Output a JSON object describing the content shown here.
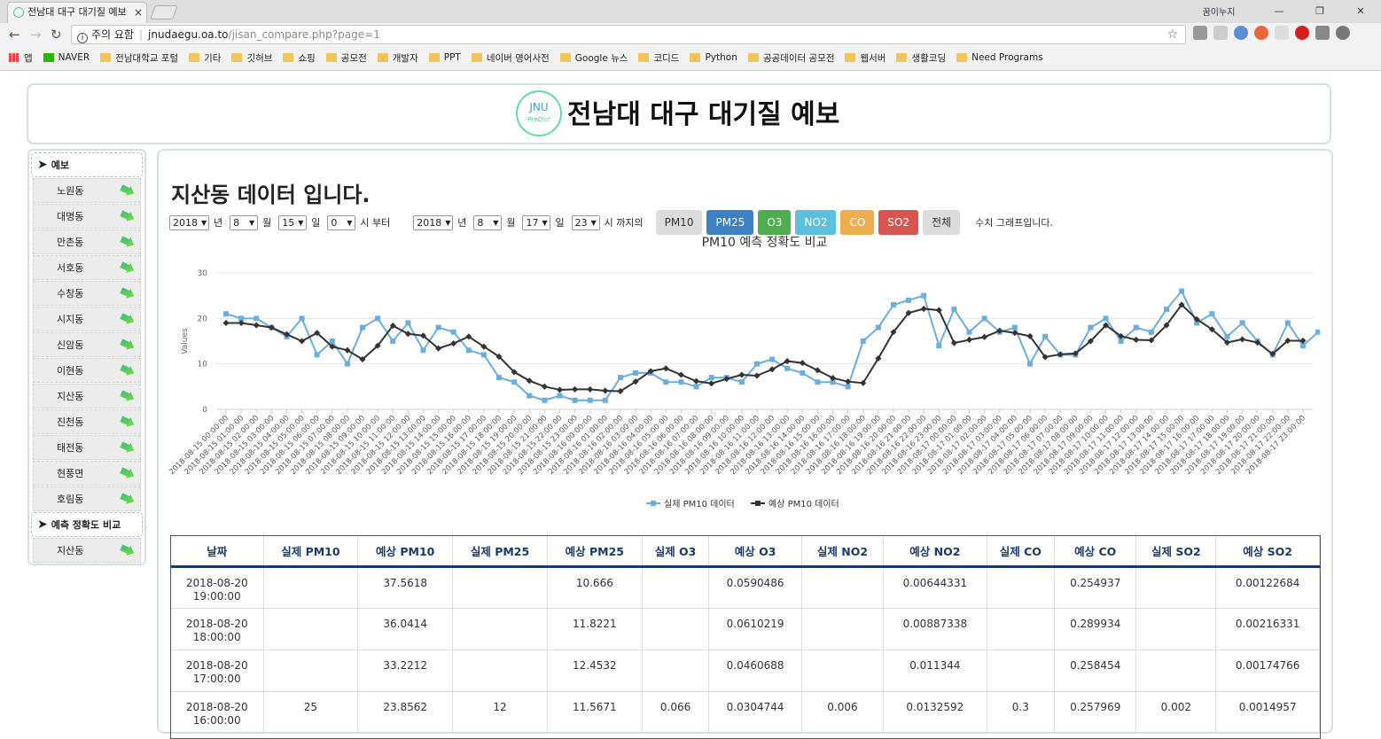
{
  "browser": {
    "tab_title": "전남대 대구 대기질 예보",
    "tab_close": "×",
    "user": "꿈이누지",
    "url_warning": "주의 요함",
    "url_host": "jnudaegu.oa.to",
    "url_path": "/jisan_compare.php?page=1",
    "bookmarks": [
      "앱",
      "NAVER",
      "전남대학교 포털",
      "기타",
      "깃허브",
      "쇼핑",
      "공모전",
      "개발자",
      "PPT",
      "네이버 영어사전",
      "Google 뉴스",
      "코디드",
      "Python",
      "공공데이터 공모전",
      "웹서버",
      "생활코딩",
      "Need Programs"
    ]
  },
  "header": {
    "logo_top": "JNU",
    "logo_bottom": "PreDict",
    "title": "전남대 대구 대기질 예보"
  },
  "sidebar": {
    "section1": "예보",
    "items": [
      "노원동",
      "대명동",
      "만촌동",
      "서호동",
      "수창동",
      "시지동",
      "신암동",
      "이현동",
      "지산동",
      "진천동",
      "태전동",
      "현풍면",
      "호림동"
    ],
    "section2": "예측 정확도 비교",
    "items2": [
      "지산동"
    ]
  },
  "page": {
    "title": "지산동 데이터 입니다."
  },
  "controls": {
    "from": {
      "year": "2018",
      "month": "8",
      "day": "15",
      "hour": "0"
    },
    "to": {
      "year": "2018",
      "month": "8",
      "day": "17",
      "hour": "23"
    },
    "year_label": "년",
    "month_label": "월",
    "day_label": "일",
    "from_suffix": "시 부터",
    "to_suffix": "시 까지의",
    "graph_note": "수치 그래프입니다."
  },
  "buttons": [
    {
      "label": "PM10",
      "color": "#dcdcdc",
      "text": "#333"
    },
    {
      "label": "PM25",
      "color": "#3b82c4",
      "text": "#fff"
    },
    {
      "label": "O3",
      "color": "#4cae4c",
      "text": "#fff"
    },
    {
      "label": "NO2",
      "color": "#5bc0de",
      "text": "#fff"
    },
    {
      "label": "CO",
      "color": "#f0ad4e",
      "text": "#fff"
    },
    {
      "label": "SO2",
      "color": "#d9534f",
      "text": "#fff"
    },
    {
      "label": "전체",
      "color": "#dcdcdc",
      "text": "#333"
    }
  ],
  "chart_data": {
    "type": "line",
    "title": "PM10 예측 정확도 비교",
    "ylabel": "Values",
    "ylim": [
      0,
      30
    ],
    "yticks": [
      0,
      10,
      20,
      30
    ],
    "start": "2018-08-15 00:00:00",
    "x_labels": [
      "2018-08-15 00:00:00",
      "2018-08-15 01:00:00",
      "2018-08-15 02:00:00",
      "2018-08-15 03:00:00",
      "2018-08-15 04:00:00",
      "2018-08-15 05:00:00",
      "2018-08-15 06:00:00",
      "2018-08-15 07:00:00",
      "2018-08-15 08:00:00",
      "2018-08-15 09:00:00",
      "2018-08-15 10:00:00",
      "2018-08-15 11:00:00",
      "2018-08-15 12:00:00",
      "2018-08-15 13:00:00",
      "2018-08-15 14:00:00",
      "2018-08-15 15:00:00",
      "2018-08-15 16:00:00",
      "2018-08-15 17:00:00",
      "2018-08-15 18:00:00",
      "2018-08-15 19:00:00",
      "2018-08-15 20:00:00",
      "2018-08-15 21:00:00",
      "2018-08-15 22:00:00",
      "2018-08-15 23:00:00",
      "2018-08-16 00:00:00",
      "2018-08-16 01:00:00",
      "2018-08-16 02:00:00",
      "2018-08-16 03:00:00",
      "2018-08-16 04:00:00",
      "2018-08-16 05:00:00",
      "2018-08-16 06:00:00",
      "2018-08-16 07:00:00",
      "2018-08-16 08:00:00",
      "2018-08-16 09:00:00",
      "2018-08-16 10:00:00",
      "2018-08-16 11:00:00",
      "2018-08-16 12:00:00",
      "2018-08-16 13:00:00",
      "2018-08-16 14:00:00",
      "2018-08-16 15:00:00",
      "2018-08-16 16:00:00",
      "2018-08-16 17:00:00",
      "2018-08-16 18:00:00",
      "2018-08-16 19:00:00",
      "2018-08-16 20:00:00",
      "2018-08-16 21:00:00",
      "2018-08-16 22:00:00",
      "2018-08-16 23:00:00",
      "2018-08-17 00:00:00",
      "2018-08-17 01:00:00",
      "2018-08-17 02:00:00",
      "2018-08-17 03:00:00",
      "2018-08-17 04:00:00",
      "2018-08-17 05:00:00",
      "2018-08-17 06:00:00",
      "2018-08-17 07:00:00",
      "2018-08-17 08:00:00",
      "2018-08-17 09:00:00",
      "2018-08-17 10:00:00",
      "2018-08-17 11:00:00",
      "2018-08-17 12:00:00",
      "2018-08-17 13:00:00",
      "2018-08-17 14:00:00",
      "2018-08-17 15:00:00",
      "2018-08-17 16:00:00",
      "2018-08-17 17:00:00",
      "2018-08-17 18:00:00",
      "2018-08-17 19:00:00",
      "2018-08-17 20:00:00",
      "2018-08-17 21:00:00",
      "2018-08-17 22:00:00",
      "2018-08-17 23:00:00"
    ],
    "series": [
      {
        "name": "실제 PM10 데이터",
        "color": "#6aaee0",
        "values": [
          21,
          20,
          20,
          18,
          16,
          20,
          12,
          15,
          10,
          18,
          20,
          15,
          19,
          13,
          18,
          17,
          13,
          12,
          7,
          6,
          3,
          2,
          3,
          2,
          2,
          2,
          7,
          8,
          8,
          6,
          6,
          5,
          7,
          7,
          6,
          10,
          11,
          9,
          8,
          6,
          6,
          5,
          15,
          18,
          23,
          24,
          25,
          14,
          22,
          17,
          20,
          17,
          18,
          10,
          16,
          12,
          12,
          18,
          20,
          15,
          18,
          17,
          22,
          26,
          19,
          21,
          16,
          19,
          15,
          12,
          19,
          14,
          17
        ]
      },
      {
        "name": "예상 PM10 데이터",
        "color": "#333333",
        "values": [
          19,
          19,
          18.5,
          18,
          16.5,
          15,
          16.8,
          13.8,
          13,
          11,
          14,
          18.4,
          16.6,
          16.2,
          13.4,
          14.5,
          16,
          13.8,
          11.6,
          8.2,
          6.3,
          5,
          4.3,
          4.4,
          4.4,
          4.1,
          4,
          6.1,
          8.4,
          9,
          7.6,
          6.2,
          5.7,
          6.7,
          7.6,
          7.4,
          8.8,
          10.6,
          10.2,
          8.6,
          6.9,
          6.1,
          5.8,
          11.2,
          17,
          21.2,
          22.1,
          21.8,
          14.6,
          15.3,
          15.9,
          17.3,
          16.8,
          16.1,
          11.5,
          12.1,
          12.3,
          15,
          18.5,
          16.1,
          15.3,
          15.2,
          18.5,
          23,
          19.8,
          17.6,
          14.7,
          15.4,
          14.7,
          12.2,
          15.1,
          15.1
        ]
      }
    ]
  },
  "table": {
    "headers": [
      "날짜",
      "실제 PM10",
      "예상 PM10",
      "실제 PM25",
      "예상 PM25",
      "실제 O3",
      "예상 O3",
      "실제 NO2",
      "예상 NO2",
      "실제 CO",
      "예상 CO",
      "실제 SO2",
      "예상 SO2"
    ],
    "rows": [
      [
        "2018-08-20 19:00:00",
        "",
        "37.5618",
        "",
        "10.666",
        "",
        "0.0590486",
        "",
        "0.00644331",
        "",
        "0.254937",
        "",
        "0.00122684"
      ],
      [
        "2018-08-20 18:00:00",
        "",
        "36.0414",
        "",
        "11.8221",
        "",
        "0.0610219",
        "",
        "0.00887338",
        "",
        "0.289934",
        "",
        "0.00216331"
      ],
      [
        "2018-08-20 17:00:00",
        "",
        "33.2212",
        "",
        "12.4532",
        "",
        "0.0460688",
        "",
        "0.011344",
        "",
        "0.258454",
        "",
        "0.00174766"
      ],
      [
        "2018-08-20 16:00:00",
        "25",
        "23.8562",
        "12",
        "11.5671",
        "0.066",
        "0.0304744",
        "0.006",
        "0.0132592",
        "0.3",
        "0.257969",
        "0.002",
        "0.0014957"
      ]
    ]
  }
}
